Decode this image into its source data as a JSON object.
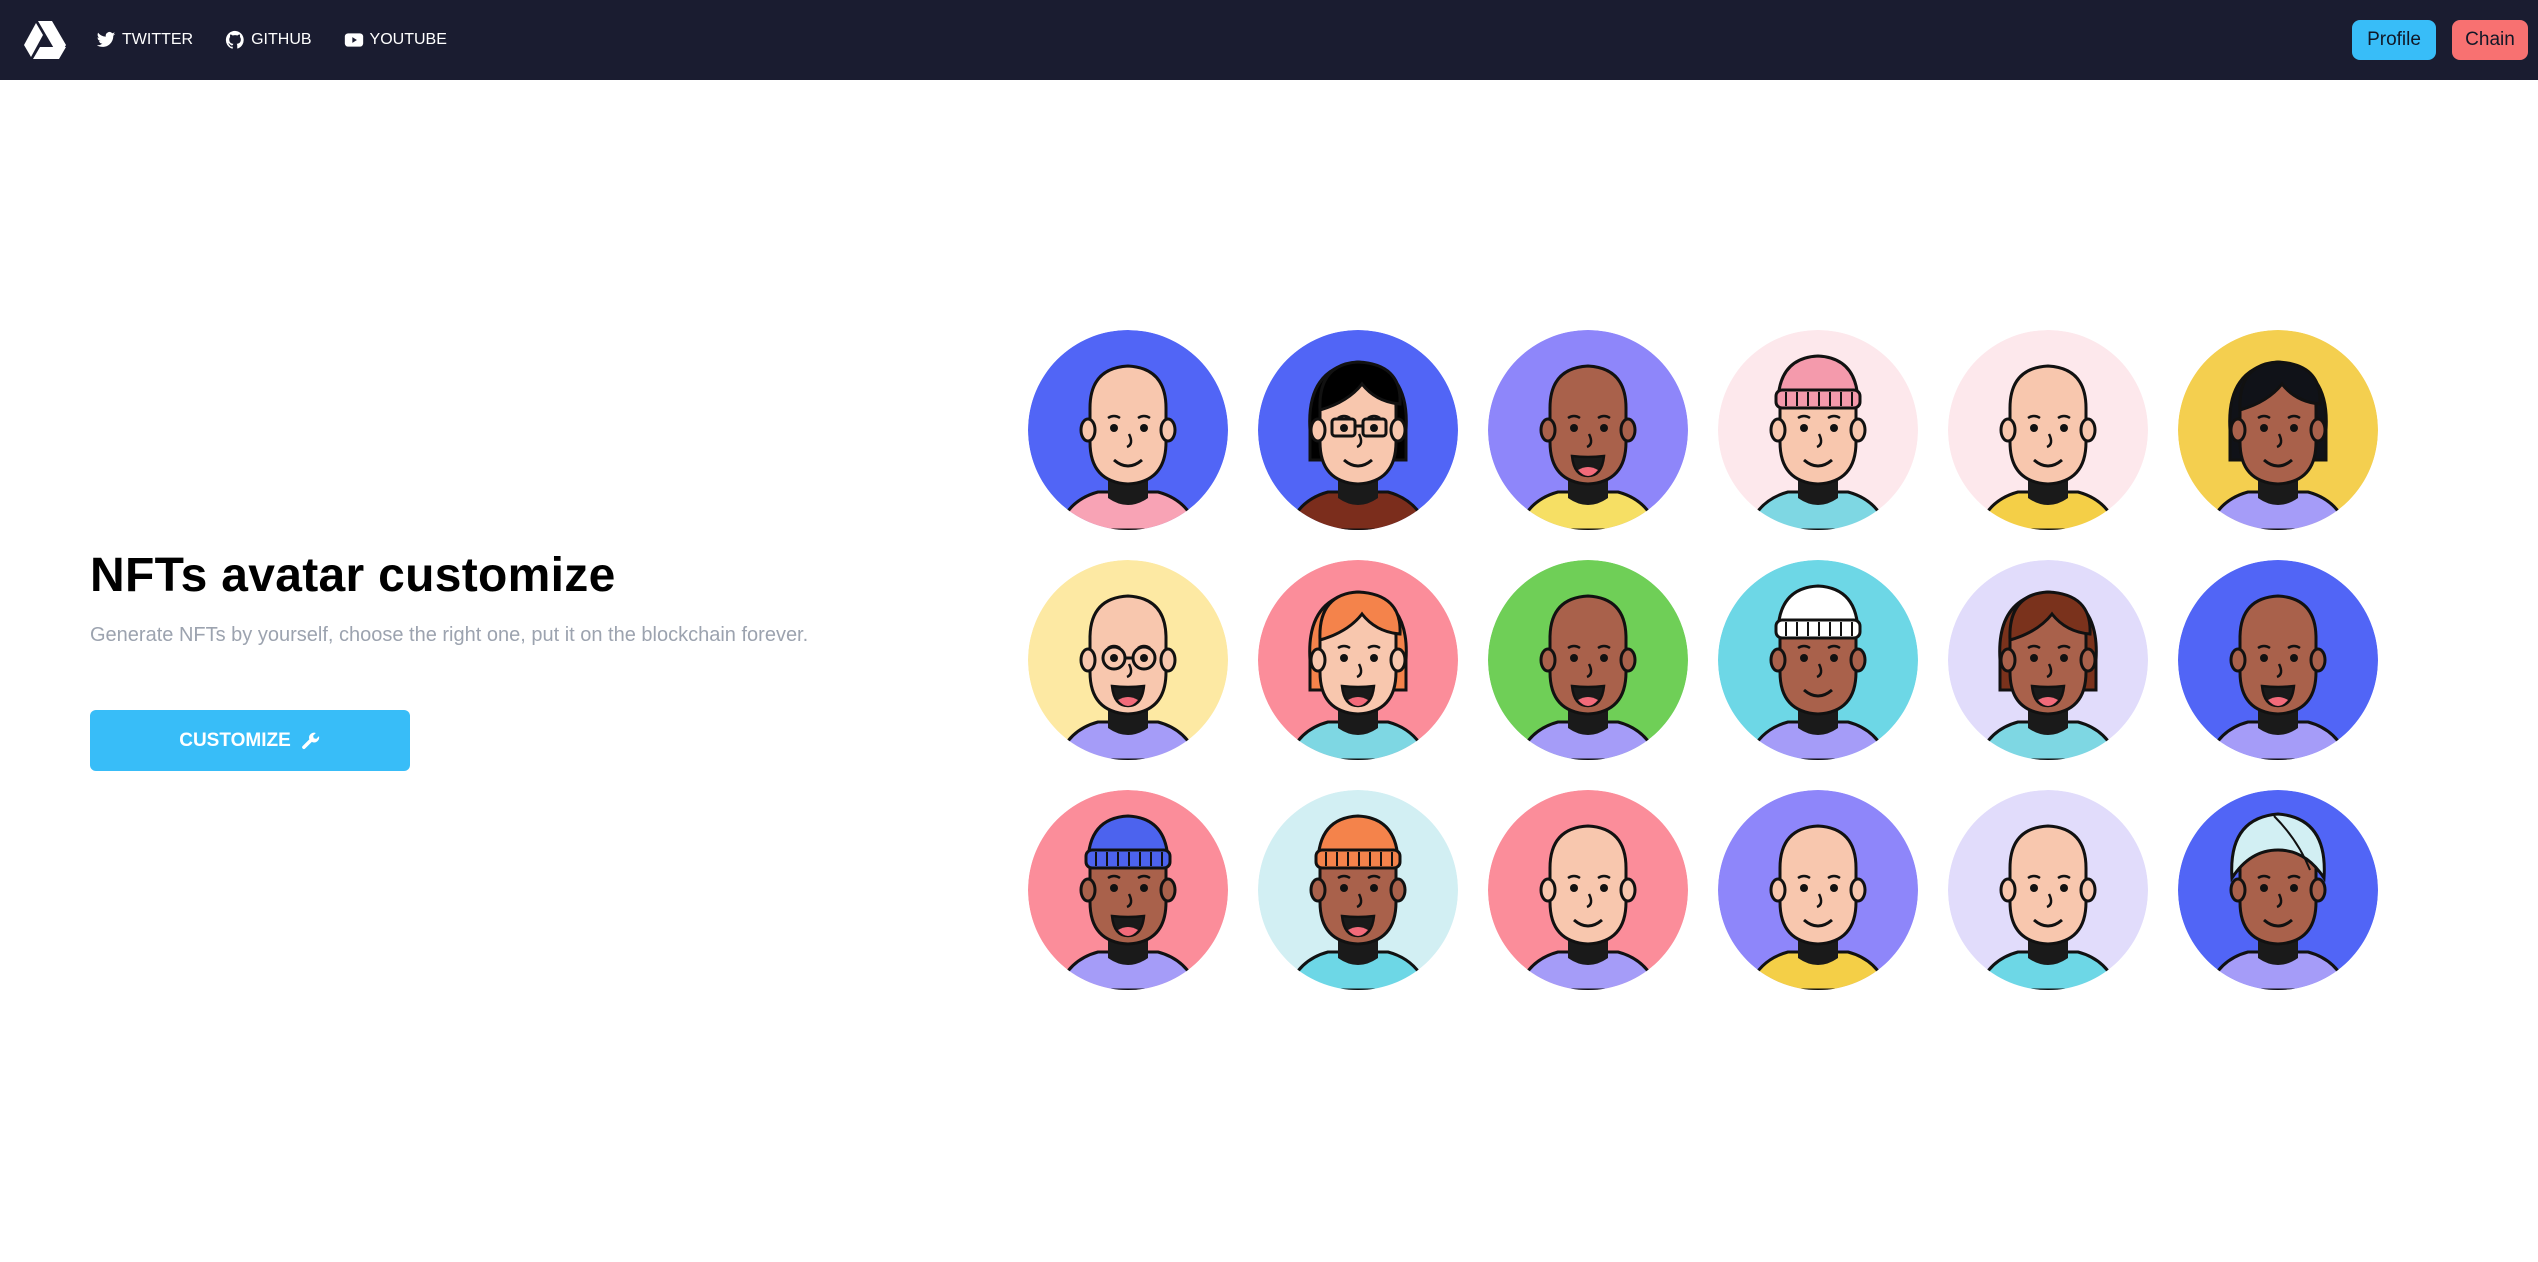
{
  "nav": {
    "links": [
      {
        "label": "TWITTER",
        "icon": "twitter-icon"
      },
      {
        "label": "GITHUB",
        "icon": "github-icon"
      },
      {
        "label": "YOUTUBE",
        "icon": "youtube-icon"
      }
    ],
    "profile_label": "Profile",
    "chain_label": "Chain"
  },
  "hero": {
    "title": "NFTs avatar customize",
    "subtitle": "Generate NFTs by yourself, choose the right one, put it on the blockchain forever.",
    "cta_label": "CUSTOMIZE",
    "cta_icon": "wrench-icon"
  },
  "colors": {
    "topbar": "#1a1c30",
    "accent": "#38bdf8",
    "chain": "#f87171",
    "subtitle": "#9ca3af"
  },
  "avatars": [
    {
      "bg": "#5165f6",
      "skin": "#f8c7ae",
      "shirt": "#f8a3b5",
      "hair": "none",
      "hairColor": "",
      "glasses": "none",
      "mouth": "smile"
    },
    {
      "bg": "#5165f6",
      "skin": "#f8c7ae",
      "shirt": "#7b2d1c",
      "hair": "bob",
      "hairColor": "#000000",
      "glasses": "square",
      "mouth": "smile"
    },
    {
      "bg": "#8e86fa",
      "skin": "#a9614b",
      "shirt": "#f6df64",
      "hair": "none",
      "hairColor": "",
      "glasses": "none",
      "mouth": "laugh"
    },
    {
      "bg": "#fde8ec",
      "skin": "#f8c7ae",
      "shirt": "#7ed7e3",
      "hair": "beanie",
      "hairColor": "#f49aac",
      "glasses": "none",
      "mouth": "smile"
    },
    {
      "bg": "#fde8ec",
      "skin": "#f8c7ae",
      "shirt": "#f4cf47",
      "hair": "none",
      "hairColor": "",
      "glasses": "none",
      "mouth": "smile"
    },
    {
      "bg": "#f4cf4f",
      "skin": "#a9614b",
      "shirt": "#a59cf8",
      "hair": "sidecut",
      "hairColor": "#101218",
      "glasses": "none",
      "mouth": "smile"
    },
    {
      "bg": "#fde9a3",
      "skin": "#f8c7ae",
      "shirt": "#a59cf8",
      "hair": "none",
      "hairColor": "",
      "glasses": "round",
      "mouth": "laugh"
    },
    {
      "bg": "#fb8d9a",
      "skin": "#f8c7ae",
      "shirt": "#7ed7e3",
      "hair": "bob",
      "hairColor": "#f4834b",
      "glasses": "none",
      "mouth": "laugh"
    },
    {
      "bg": "#6fcf57",
      "skin": "#a9614b",
      "shirt": "#a59cf8",
      "hair": "none",
      "hairColor": "",
      "glasses": "none",
      "mouth": "laugh"
    },
    {
      "bg": "#6dd7e6",
      "skin": "#a9614b",
      "shirt": "#a59cf8",
      "hair": "beanie",
      "hairColor": "#ffffff",
      "glasses": "none",
      "mouth": "smile"
    },
    {
      "bg": "#e1dcfb",
      "skin": "#a9614b",
      "shirt": "#7ed7e3",
      "hair": "bob",
      "hairColor": "#7a321c",
      "glasses": "none",
      "mouth": "laugh"
    },
    {
      "bg": "#5165f6",
      "skin": "#a9614b",
      "shirt": "#a59cf8",
      "hair": "none",
      "hairColor": "",
      "glasses": "none",
      "mouth": "laugh"
    },
    {
      "bg": "#fb8d9a",
      "skin": "#a9614b",
      "shirt": "#a59cf8",
      "hair": "beanie",
      "hairColor": "#4c63ee",
      "glasses": "none",
      "mouth": "laugh"
    },
    {
      "bg": "#d2eff3",
      "skin": "#a9614b",
      "shirt": "#6dd7e6",
      "hair": "beanie",
      "hairColor": "#f4834b",
      "glasses": "none",
      "mouth": "laugh"
    },
    {
      "bg": "#fb8d9a",
      "skin": "#f8c7ae",
      "shirt": "#a59cf8",
      "hair": "none",
      "hairColor": "",
      "glasses": "none",
      "mouth": "smile"
    },
    {
      "bg": "#8e86fa",
      "skin": "#f8c7ae",
      "shirt": "#f4cf47",
      "hair": "none",
      "hairColor": "",
      "glasses": "none",
      "mouth": "smile"
    },
    {
      "bg": "#e1dcfb",
      "skin": "#f8c7ae",
      "shirt": "#6dd7e6",
      "hair": "none",
      "hairColor": "",
      "glasses": "none",
      "mouth": "smile"
    },
    {
      "bg": "#5165f6",
      "skin": "#a9614b",
      "shirt": "#a59cf8",
      "hair": "turban",
      "hairColor": "#d2eff3",
      "glasses": "none",
      "mouth": "smile"
    }
  ]
}
